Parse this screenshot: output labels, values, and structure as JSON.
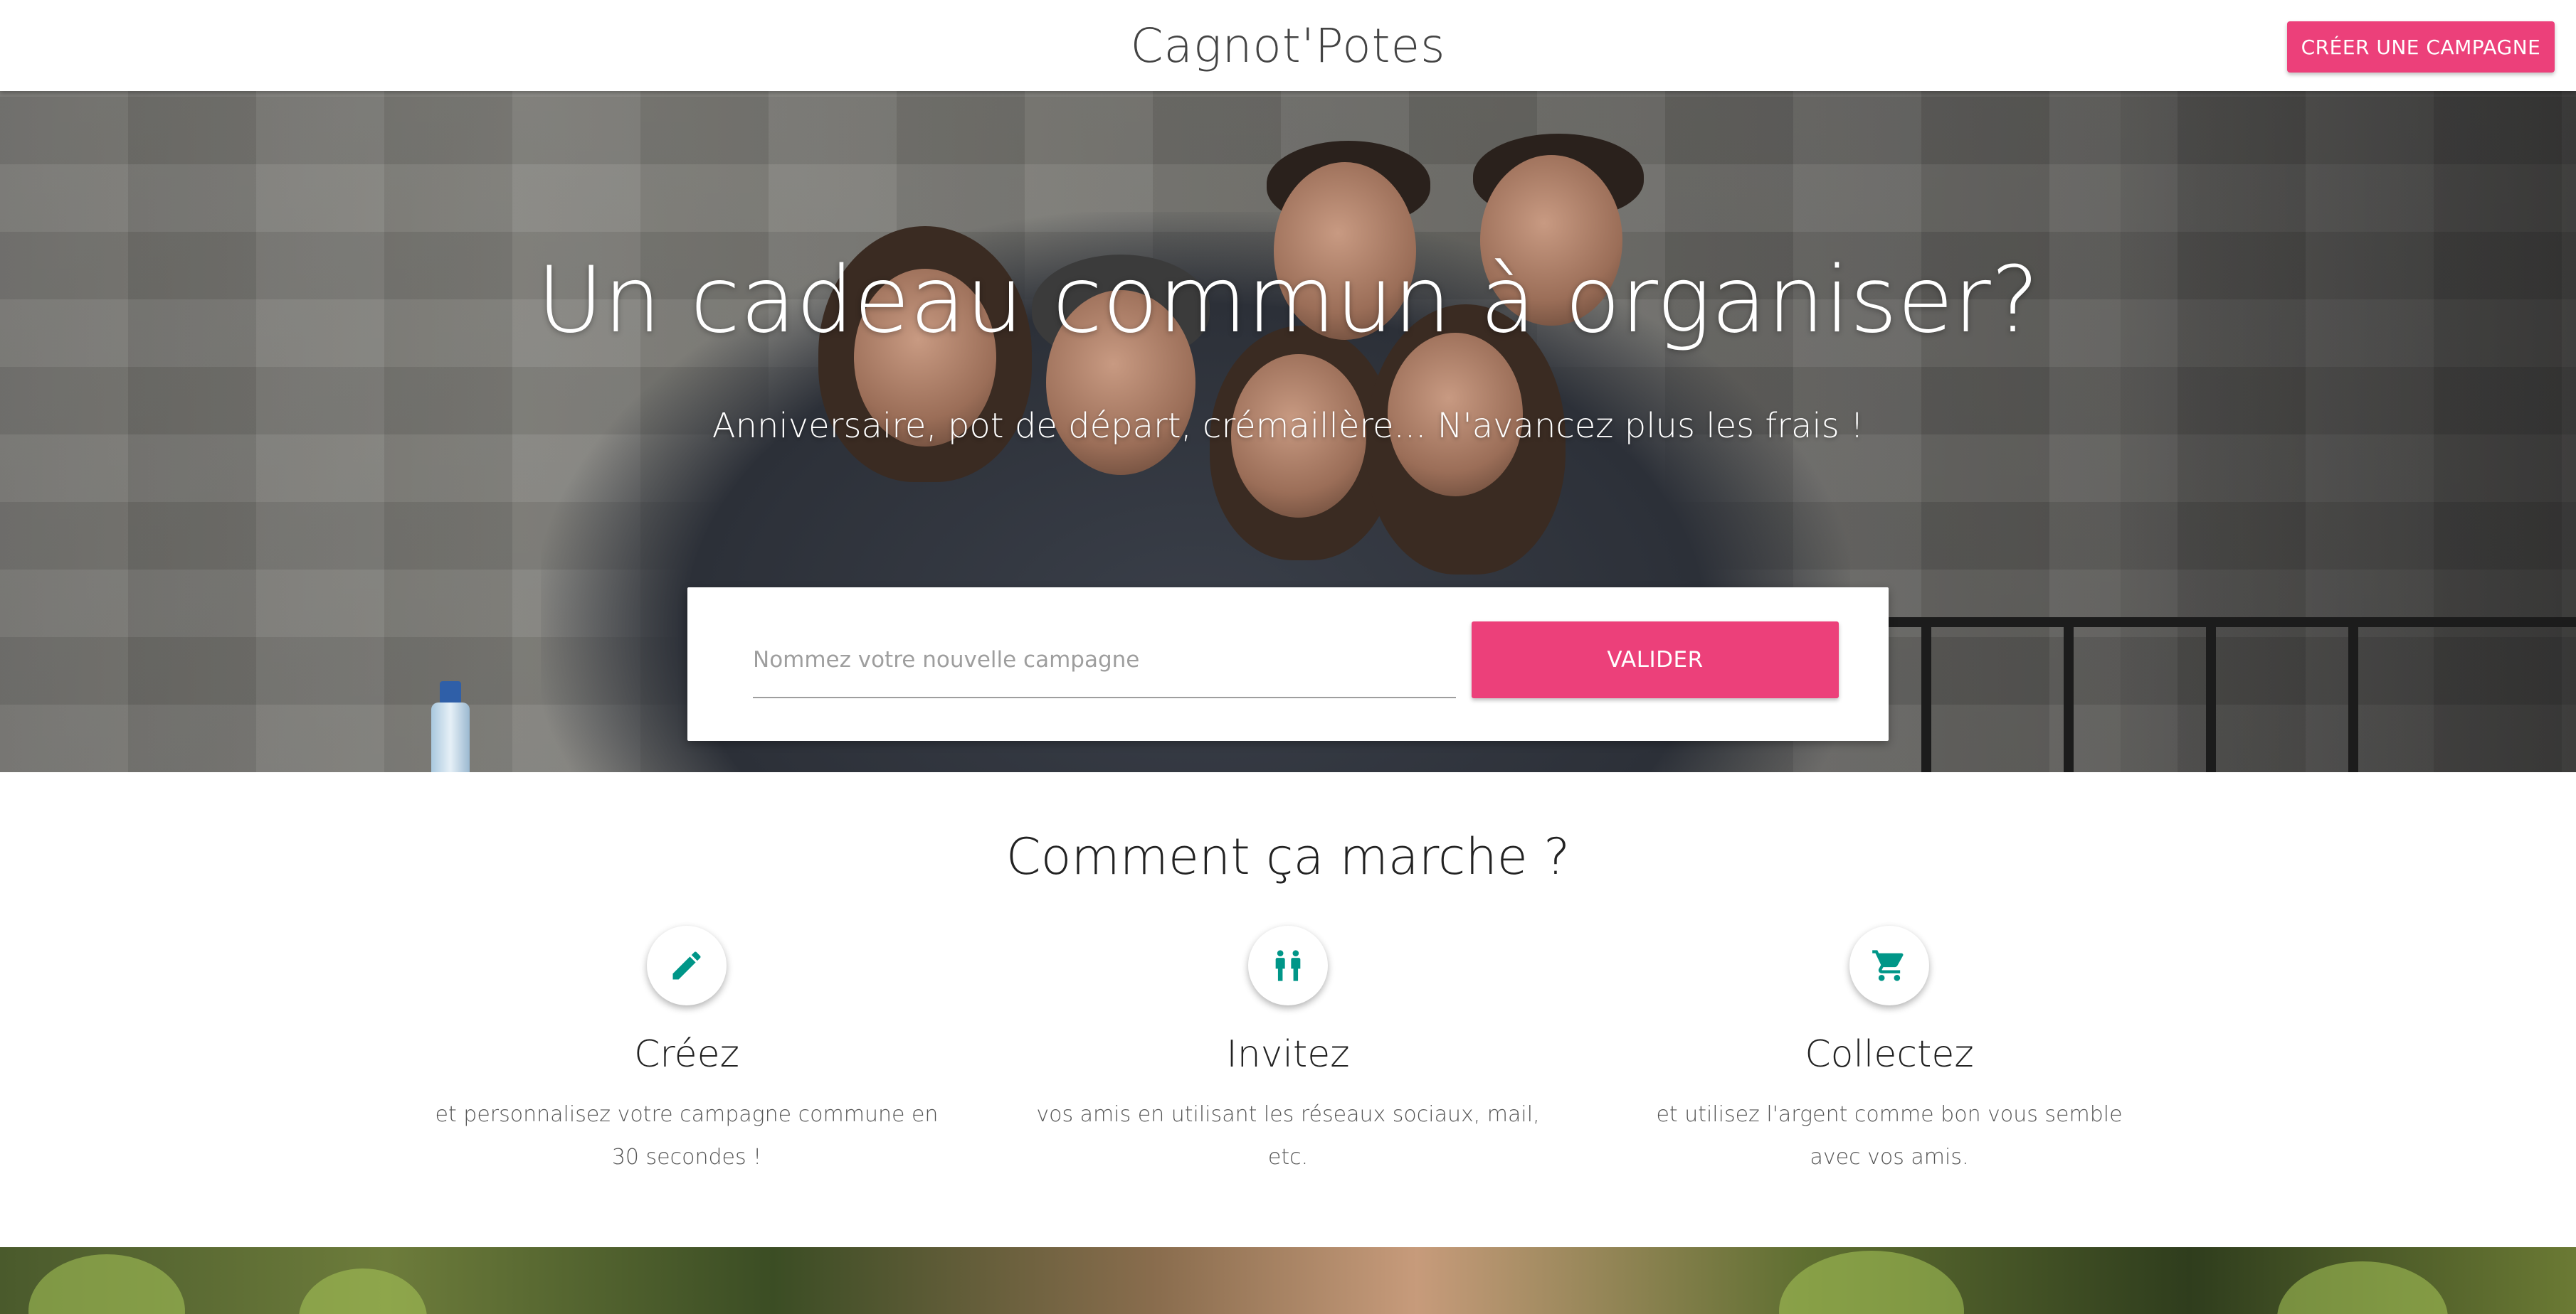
{
  "header": {
    "brand": "Cagnot'Potes",
    "create_button": "CRÉER UNE CAMPAGNE"
  },
  "hero": {
    "title": "Un cadeau commun à organiser?",
    "subtitle": "Anniversaire, pot de départ, crémaillère... N'avancez plus les frais !",
    "form": {
      "input_value": "",
      "input_placeholder": "Nommez votre nouvelle campagne",
      "submit_button": "VALIDER"
    }
  },
  "how_it_works": {
    "title": "Comment ça marche ?",
    "steps": [
      {
        "icon": "pencil-icon",
        "title": "Créez",
        "description": "et personnalisez votre campagne commune en 30 secondes !"
      },
      {
        "icon": "people-icon",
        "title": "Invitez",
        "description": "vos amis en utilisant les réseaux sociaux, mail, etc."
      },
      {
        "icon": "cart-icon",
        "title": "Collectez",
        "description": "et utilisez l'argent comme bon vous semble avec vos amis."
      }
    ]
  },
  "colors": {
    "accent": "#ec407a",
    "icon_teal": "#009688"
  }
}
